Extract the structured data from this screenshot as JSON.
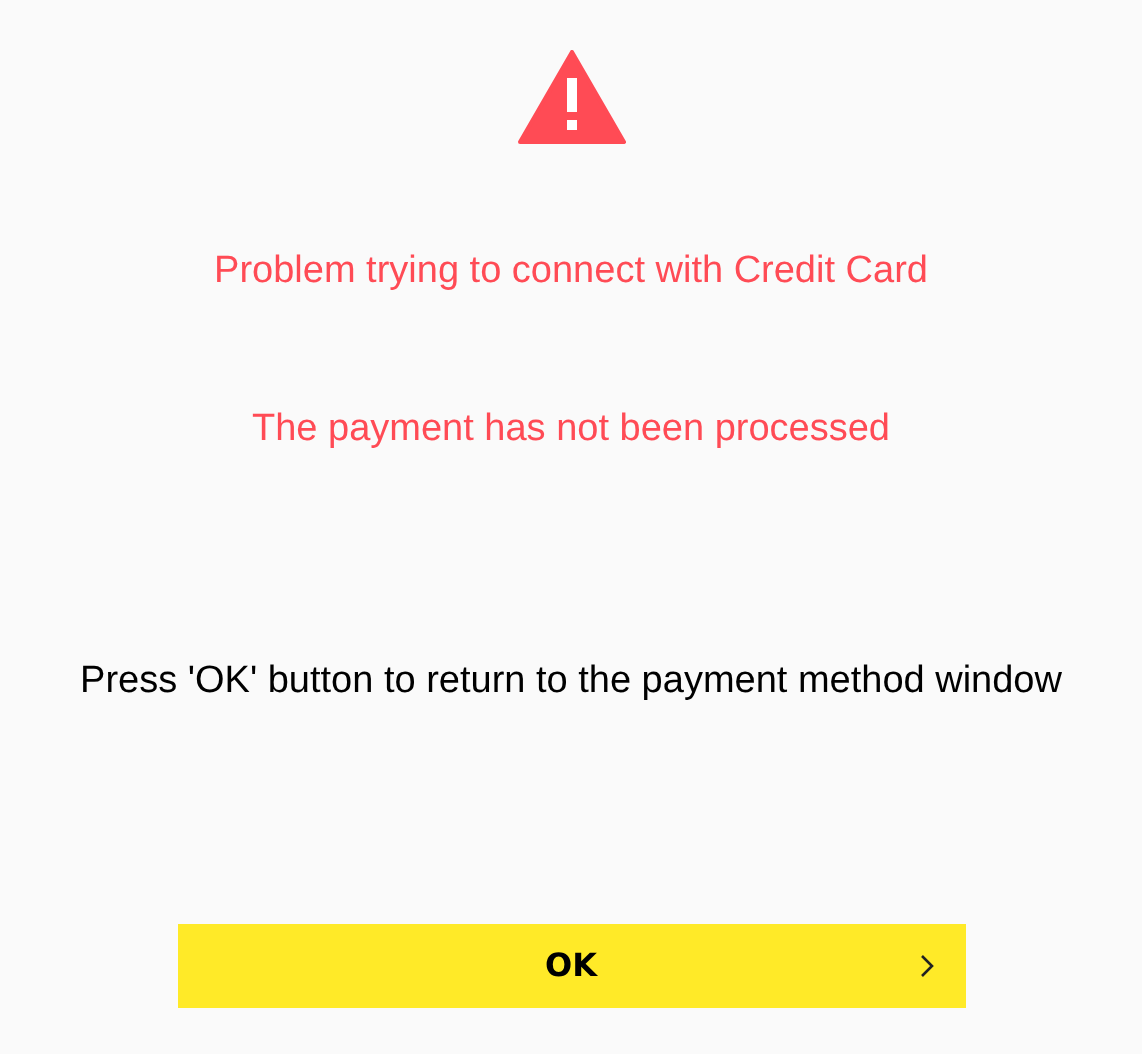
{
  "error": {
    "title": "Problem trying to connect with Credit Card",
    "subtitle": "The payment has not been processed"
  },
  "instruction": "Press 'OK' button to return to the payment method window",
  "button": {
    "label": "OK"
  }
}
